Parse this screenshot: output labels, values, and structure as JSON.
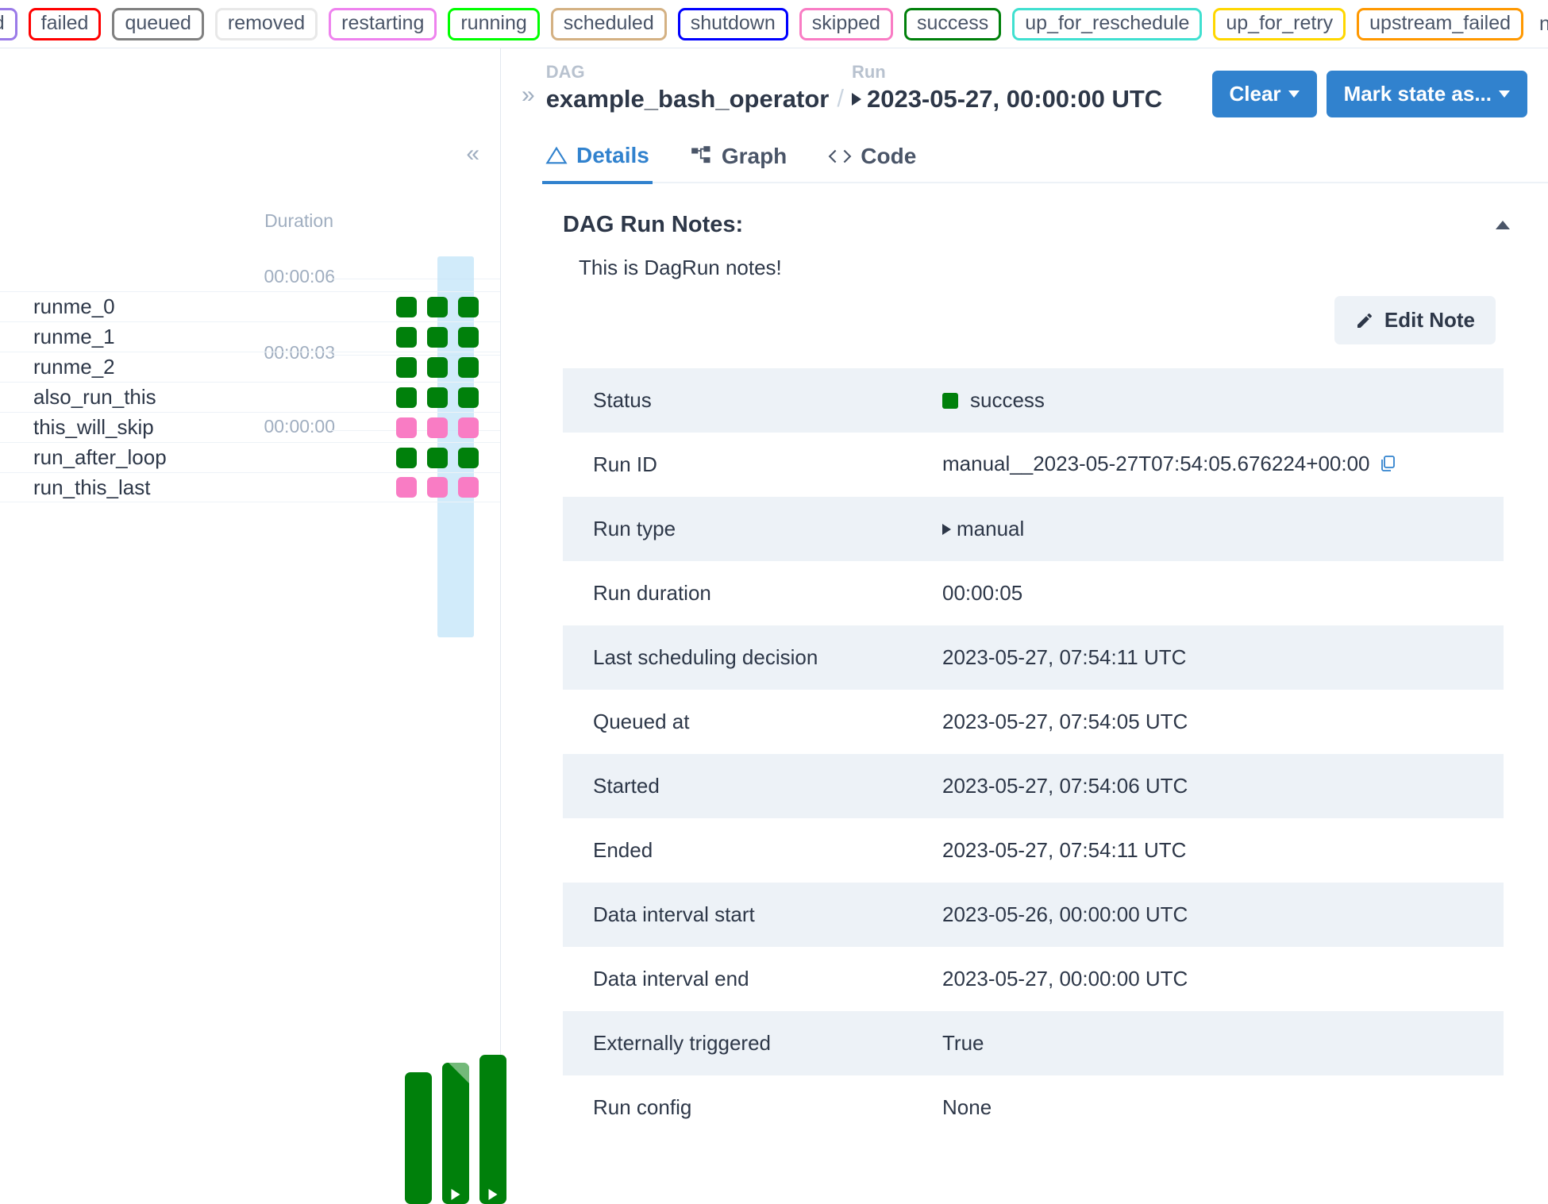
{
  "legend": {
    "badges": [
      {
        "label": "deferred",
        "color": "#9a7ae8"
      },
      {
        "label": "failed",
        "color": "#ff0000"
      },
      {
        "label": "queued",
        "color": "#808080"
      },
      {
        "label": "removed",
        "color": "#e8e8e8"
      },
      {
        "label": "restarting",
        "color": "#ee82ee"
      },
      {
        "label": "running",
        "color": "#00ff00"
      },
      {
        "label": "scheduled",
        "color": "#d4b183"
      },
      {
        "label": "shutdown",
        "color": "#0000ff"
      },
      {
        "label": "skipped",
        "color": "#f97cc4"
      },
      {
        "label": "success",
        "color": "#00800b"
      },
      {
        "label": "up_for_reschedule",
        "color": "#40e0d0"
      },
      {
        "label": "up_for_retry",
        "color": "#ffd700"
      },
      {
        "label": "upstream_failed",
        "color": "#ff9800"
      }
    ],
    "no_status_label": "no_status"
  },
  "grid": {
    "collapse_icon": "«",
    "duration_title": "Duration",
    "axis_ticks": [
      "00:00:06",
      "00:00:03",
      "00:00:00"
    ],
    "bars": [
      {
        "duration_seconds": 5.2,
        "selected": false,
        "has_marker": false,
        "partial": false
      },
      {
        "duration_seconds": 5.6,
        "selected": true,
        "has_marker": true,
        "partial": true
      },
      {
        "duration_seconds": 5.9,
        "selected": false,
        "has_marker": true,
        "partial": false
      }
    ],
    "tasks": [
      {
        "name": "runme_0",
        "states": [
          "success",
          "success",
          "success"
        ]
      },
      {
        "name": "runme_1",
        "states": [
          "success",
          "success",
          "success"
        ]
      },
      {
        "name": "runme_2",
        "states": [
          "success",
          "success",
          "success"
        ]
      },
      {
        "name": "also_run_this",
        "states": [
          "success",
          "success",
          "success"
        ]
      },
      {
        "name": "this_will_skip",
        "states": [
          "skipped",
          "skipped",
          "skipped"
        ]
      },
      {
        "name": "run_after_loop",
        "states": [
          "success",
          "success",
          "success"
        ]
      },
      {
        "name": "run_this_last",
        "states": [
          "skipped",
          "skipped",
          "skipped"
        ]
      }
    ]
  },
  "header": {
    "expand_icon": "»",
    "dag_caption": "DAG",
    "dag_name": "example_bash_operator",
    "separator": "/",
    "run_caption": "Run",
    "run_value": "2023-05-27, 00:00:00 UTC",
    "clear_label": "Clear",
    "mark_state_label": "Mark state as..."
  },
  "tabs": [
    {
      "label": "Details",
      "icon": "triangle-icon",
      "active": true
    },
    {
      "label": "Graph",
      "icon": "graph-icon",
      "active": false
    },
    {
      "label": "Code",
      "icon": "code-icon",
      "active": false
    }
  ],
  "notes": {
    "title": "DAG Run Notes:",
    "body": "This is DagRun notes!",
    "edit_label": "Edit Note"
  },
  "details": {
    "rows": [
      {
        "key": "Status",
        "value": "success",
        "type": "status"
      },
      {
        "key": "Run ID",
        "value": "manual__2023-05-27T07:54:05.676224+00:00",
        "type": "copyable"
      },
      {
        "key": "Run type",
        "value": "manual",
        "type": "arrow"
      },
      {
        "key": "Run duration",
        "value": "00:00:05",
        "type": "text"
      },
      {
        "key": "Last scheduling decision",
        "value": "2023-05-27, 07:54:11 UTC",
        "type": "text"
      },
      {
        "key": "Queued at",
        "value": "2023-05-27, 07:54:05 UTC",
        "type": "text"
      },
      {
        "key": "Started",
        "value": "2023-05-27, 07:54:06 UTC",
        "type": "text"
      },
      {
        "key": "Ended",
        "value": "2023-05-27, 07:54:11 UTC",
        "type": "text"
      },
      {
        "key": "Data interval start",
        "value": "2023-05-26, 00:00:00 UTC",
        "type": "text"
      },
      {
        "key": "Data interval end",
        "value": "2023-05-27, 00:00:00 UTC",
        "type": "text"
      },
      {
        "key": "Externally triggered",
        "value": "True",
        "type": "text"
      },
      {
        "key": "Run config",
        "value": "None",
        "type": "text"
      }
    ]
  }
}
